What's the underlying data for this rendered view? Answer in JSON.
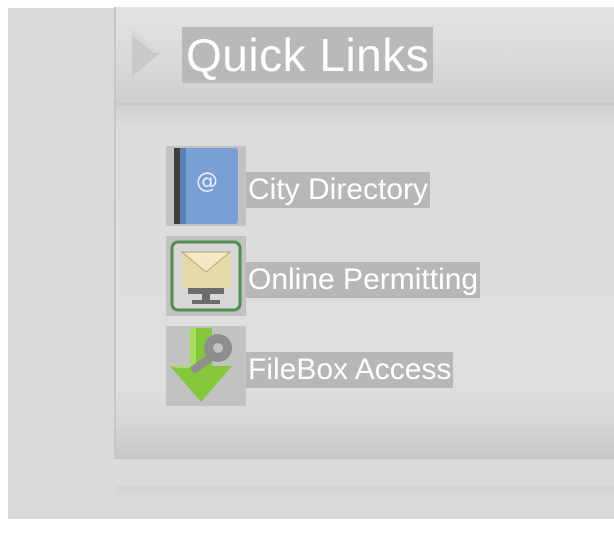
{
  "quick_links": {
    "title": "Quick Links",
    "items": [
      {
        "label": "City Directory",
        "icon": "address-book-icon"
      },
      {
        "label": "Online Permitting",
        "icon": "permit-monitor-icon"
      },
      {
        "label": "FileBox Access",
        "icon": "filebox-key-icon"
      }
    ]
  },
  "colors": {
    "background": "#dadada",
    "label_highlight": "#b7b7b7",
    "text": "#ffffff",
    "book_blue": "#7aa0d8",
    "arrow_green": "#8fcf3c"
  }
}
